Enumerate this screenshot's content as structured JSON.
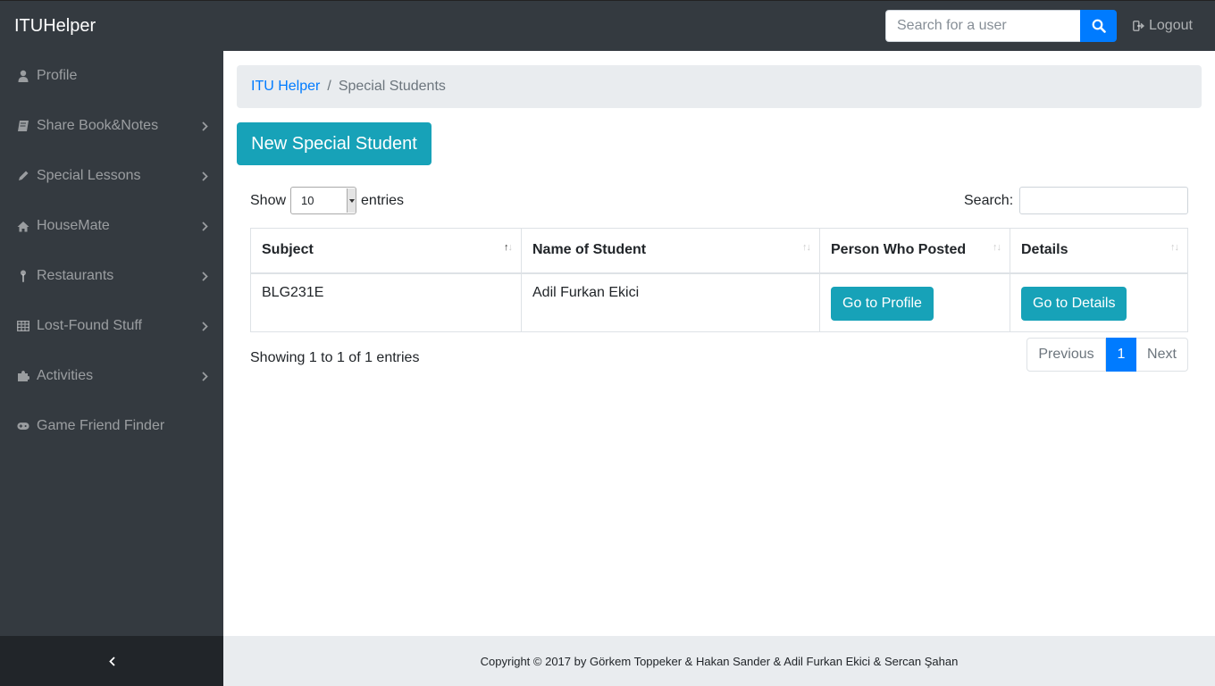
{
  "navbar": {
    "brand": "ITUHelper",
    "search_placeholder": "Search for a user",
    "logout_label": "Logout"
  },
  "sidebar": {
    "items": [
      {
        "label": "Profile",
        "icon": "user-icon",
        "has_submenu": false
      },
      {
        "label": "Share Book&Notes",
        "icon": "book-icon",
        "has_submenu": true
      },
      {
        "label": "Special Lessons",
        "icon": "pencil-icon",
        "has_submenu": true
      },
      {
        "label": "HouseMate",
        "icon": "home-icon",
        "has_submenu": true
      },
      {
        "label": "Restaurants",
        "icon": "thermometer-icon",
        "has_submenu": true
      },
      {
        "label": "Lost-Found Stuff",
        "icon": "table-icon",
        "has_submenu": true
      },
      {
        "label": "Activities",
        "icon": "puzzle-icon",
        "has_submenu": true
      },
      {
        "label": "Game Friend Finder",
        "icon": "gamepad-icon",
        "has_submenu": false
      }
    ]
  },
  "breadcrumb": {
    "home": "ITU Helper",
    "current": "Special Students"
  },
  "actions": {
    "new_label": "New Special Student"
  },
  "datatable": {
    "show_label": "Show",
    "length_value": "10",
    "entries_label": "entries",
    "search_label": "Search:",
    "columns": [
      "Subject",
      "Name of Student",
      "Person Who Posted",
      "Details"
    ],
    "rows": [
      {
        "subject": "BLG231E",
        "name": "Adil Furkan Ekici",
        "profile_btn": "Go to Profile",
        "details_btn": "Go to Details"
      }
    ],
    "info": "Showing 1 to 1 of 1 entries",
    "pagination": {
      "previous": "Previous",
      "current": "1",
      "next": "Next"
    }
  },
  "footer": {
    "text": "Copyright © 2017 by Görkem Toppeker & Hakan Sander & Adil Furkan Ekici & Sercan Şahan"
  },
  "colors": {
    "navbar": "#343a40",
    "primary": "#007bff",
    "info": "#17a2b8",
    "footer": "#e9ecef"
  }
}
